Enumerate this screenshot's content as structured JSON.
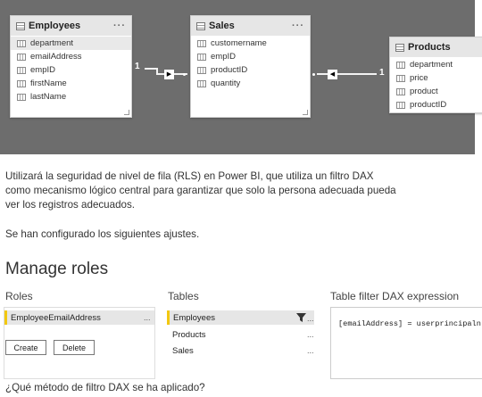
{
  "model": {
    "tables": {
      "employees": {
        "title": "Employees",
        "fields": [
          "department",
          "emailAddress",
          "empID",
          "firstName",
          "lastName"
        ]
      },
      "sales": {
        "title": "Sales",
        "fields": [
          "customername",
          "empID",
          "productID",
          "quantity"
        ]
      },
      "products": {
        "title": "Products",
        "fields": [
          "department",
          "price",
          "product",
          "productID"
        ]
      }
    },
    "rel_left_card": "1",
    "rel_right_card": "1",
    "menu_dots": "···"
  },
  "text": {
    "para1": "Utilizará la seguridad de nivel de fila (RLS) en Power BI, que utiliza un filtro DAX como mecanismo lógico central para garantizar que solo la persona adecuada pueda ver los registros adecuados.",
    "para2": "Se han configurado los siguientes ajustes.",
    "question": "¿Qué método de filtro DAX se ha aplicado?"
  },
  "manage_roles": {
    "title": "Manage roles",
    "roles_label": "Roles",
    "tables_label": "Tables",
    "filter_label": "Table filter DAX expression",
    "role_selected": "EmployeeEmailAddress",
    "create_label": "Create",
    "delete_label": "Delete",
    "tables": [
      "Employees",
      "Products",
      "Sales"
    ],
    "expression": "[emailAddress] = userprincipaln",
    "ellipsis": "..."
  }
}
